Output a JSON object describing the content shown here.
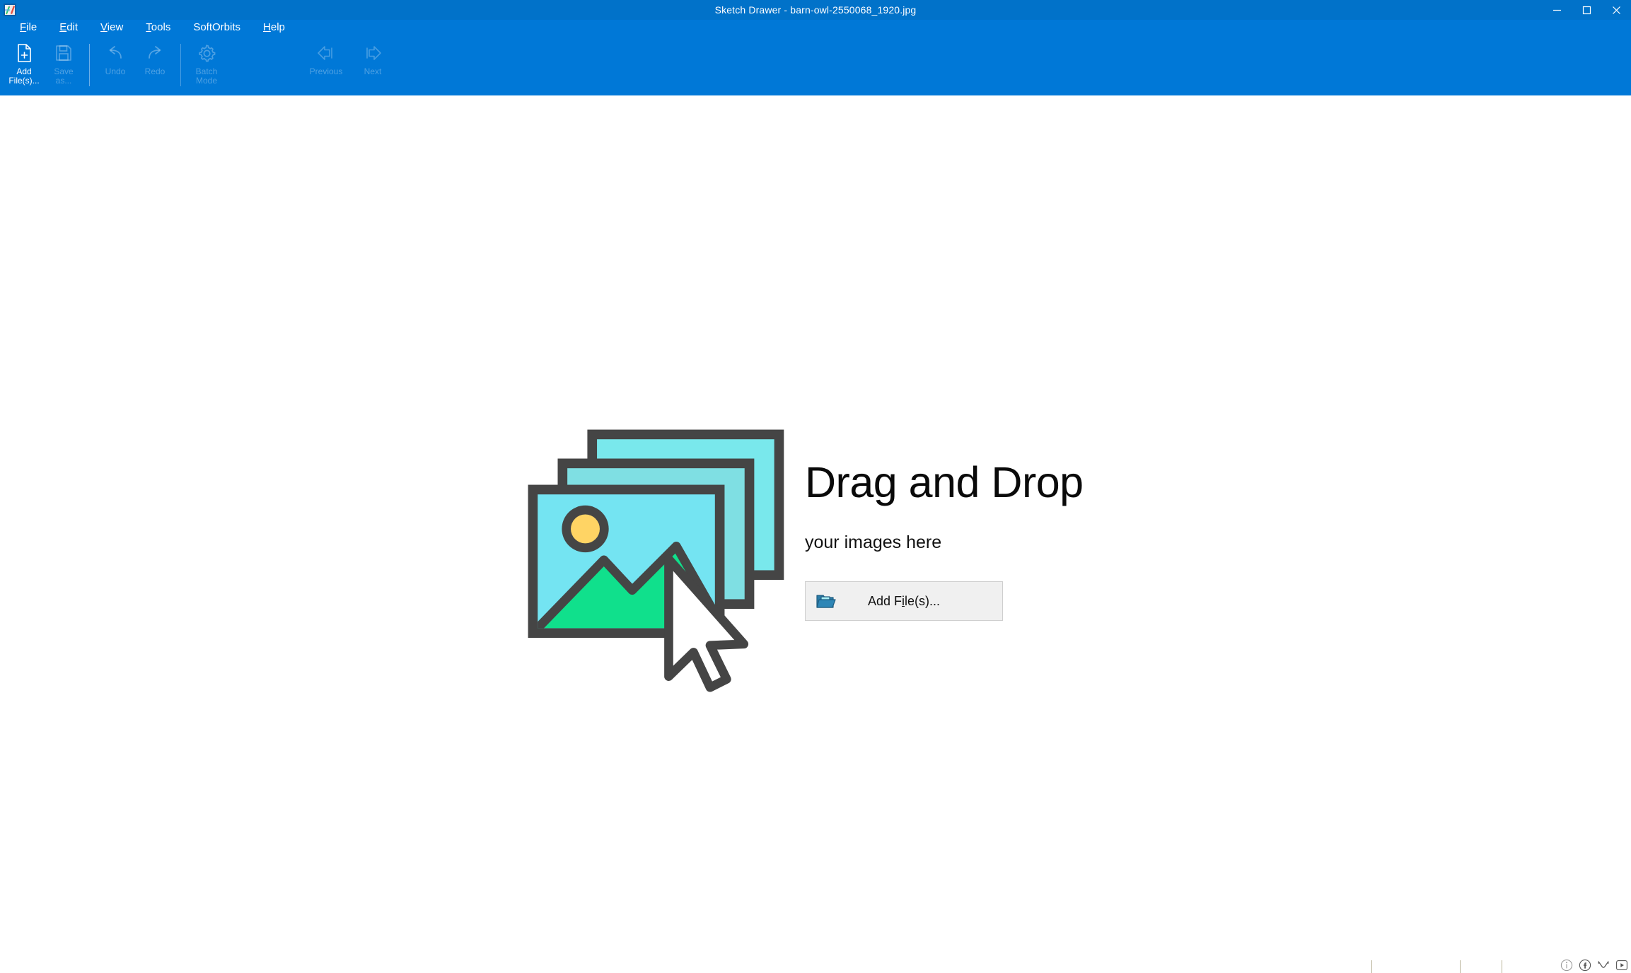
{
  "window": {
    "title": "Sketch Drawer - barn-owl-2550068_1920.jpg",
    "app_icon": "sketch-drawer-app-icon",
    "controls": {
      "minimize": "minimize-icon",
      "maximize": "maximize-icon",
      "close": "close-icon"
    },
    "titlebar_color": "#0172c9",
    "toolbar_color": "#0078d7"
  },
  "menubar": {
    "items": [
      {
        "label": "File",
        "mnemonic": "F"
      },
      {
        "label": "Edit",
        "mnemonic": "E"
      },
      {
        "label": "View",
        "mnemonic": "V"
      },
      {
        "label": "Tools",
        "mnemonic": "T"
      },
      {
        "label": "SoftOrbits",
        "mnemonic": ""
      },
      {
        "label": "Help",
        "mnemonic": "H"
      }
    ]
  },
  "toolbar": {
    "add_files": {
      "label": "Add\nFile(s)...",
      "icon": "add-file-icon",
      "enabled": true
    },
    "save_as": {
      "label": "Save\nas...",
      "icon": "save-icon",
      "enabled": false
    },
    "undo": {
      "label": "Undo",
      "icon": "undo-icon",
      "enabled": false
    },
    "redo": {
      "label": "Redo",
      "icon": "redo-icon",
      "enabled": false
    },
    "batch_mode": {
      "label": "Batch\nMode",
      "icon": "gear-icon",
      "enabled": false
    },
    "previous": {
      "label": "Previous",
      "icon": "arrow-left-icon",
      "enabled": false
    },
    "next": {
      "label": "Next",
      "icon": "arrow-right-icon",
      "enabled": false
    }
  },
  "dropzone": {
    "illustration": "image-stack-with-cursor-illustration",
    "title": "Drag and Drop",
    "subtitle": "your images here",
    "add_button": {
      "label_before": "Add F",
      "label_mnemonic": "i",
      "label_after": "le(s)...",
      "full_label": "Add File(s)...",
      "icon": "folder-open-icon"
    },
    "colors": {
      "frame_stroke": "#454545",
      "photo_sky": "#6FE6F0",
      "photo_sky_back": "#7FE3E8",
      "photo_mountain": "#10E08C",
      "photo_sun": "#FFD464",
      "cursor_fill": "#FFFFFF"
    }
  },
  "statusbar": {
    "text": "",
    "icons": [
      {
        "name": "info-icon",
        "glyph": "i"
      },
      {
        "name": "facebook-icon",
        "glyph": "f"
      },
      {
        "name": "twitter-icon",
        "glyph": "t"
      },
      {
        "name": "youtube-icon",
        "glyph": "play"
      }
    ]
  }
}
